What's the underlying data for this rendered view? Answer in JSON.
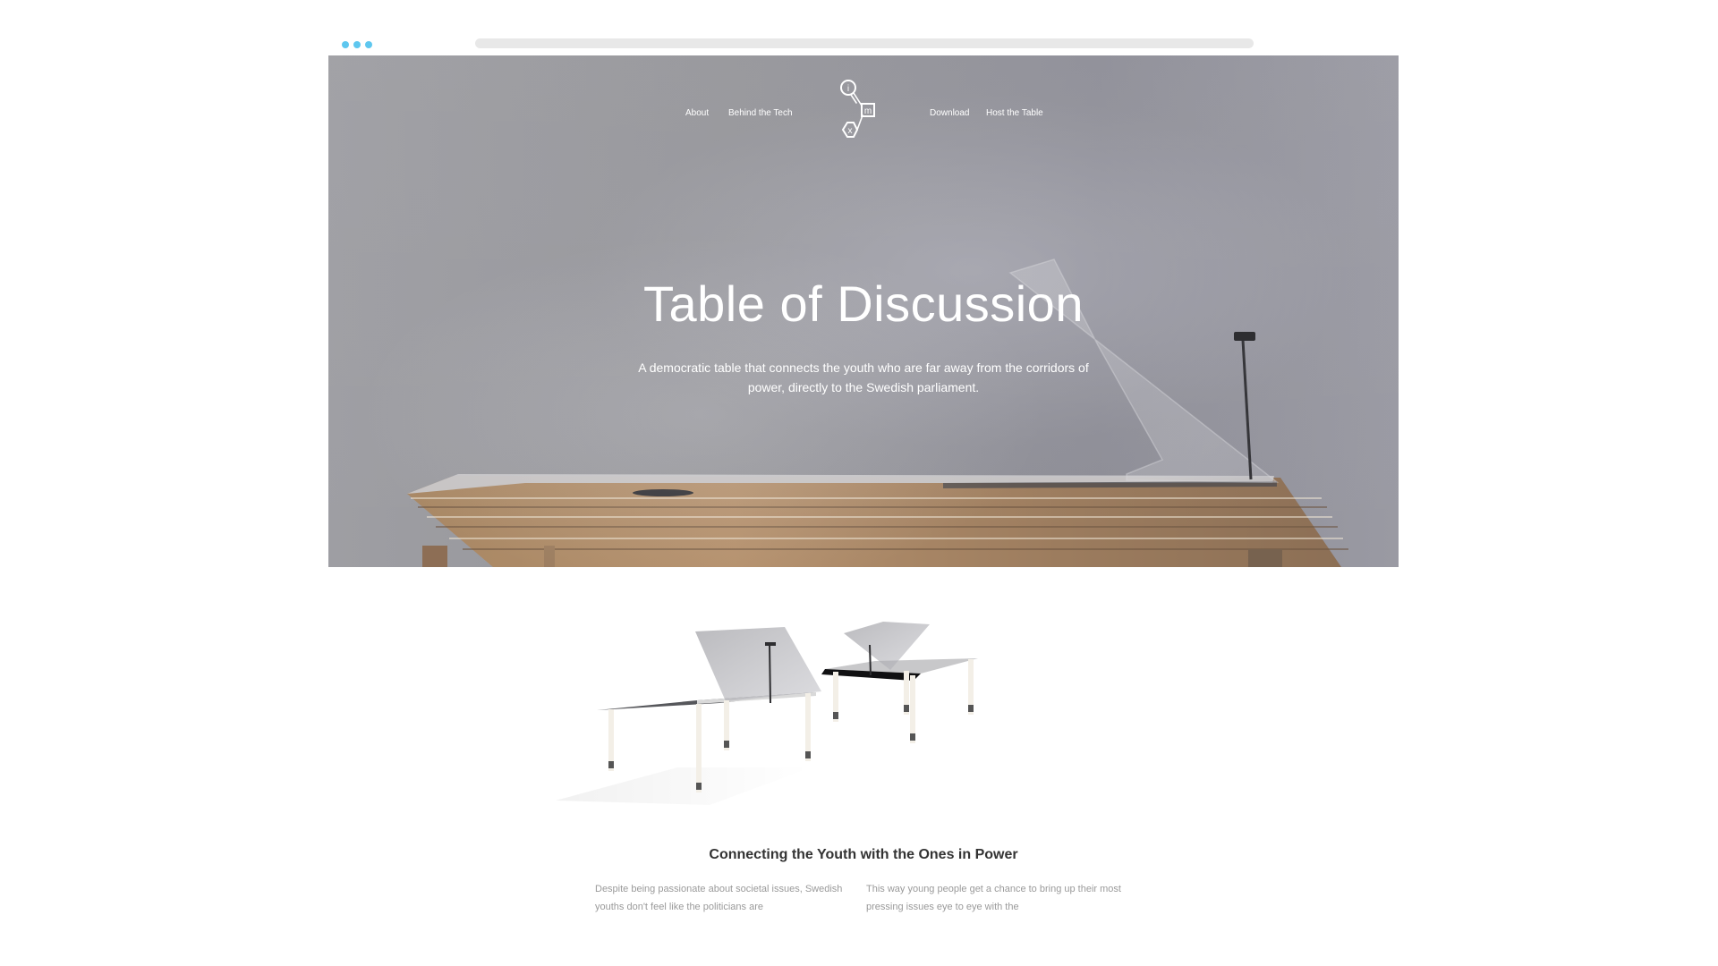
{
  "page": {
    "background": "#ffffff",
    "accent": "#5ec7ef"
  },
  "browser": {
    "window_dots": [
      "dot",
      "dot",
      "dot"
    ]
  },
  "hero": {
    "nav": {
      "left": [
        "About",
        "Behind the Tech"
      ],
      "right": [
        "Download",
        "Host the Table"
      ]
    },
    "logo_letters": [
      "i",
      "m",
      "x"
    ],
    "title": "Table of Discussion",
    "subtitle": "A democratic table that connects the youth who are far away from the corridors of power, directly to the Swedish parliament."
  },
  "content": {
    "section_title": "Connecting the Youth with the Ones in Power",
    "columns": [
      "Despite being passionate about societal issues, Swedish youths don't feel like the politicians are",
      "This way young people get a chance to bring up their most pressing issues eye to eye with the"
    ]
  }
}
